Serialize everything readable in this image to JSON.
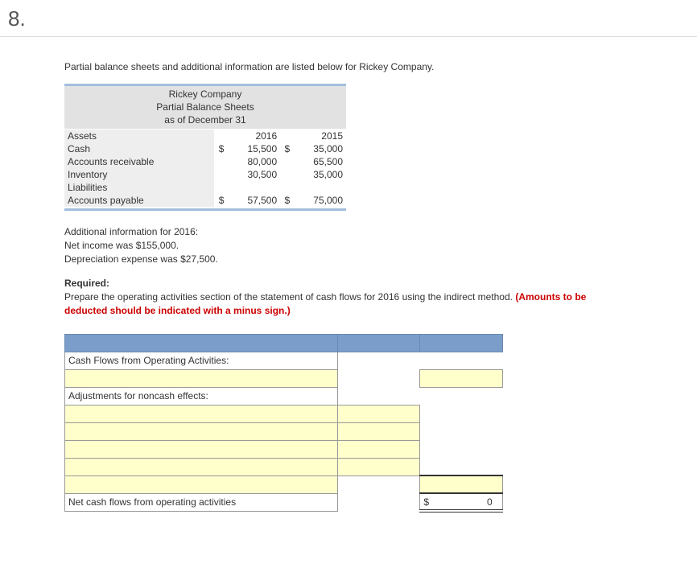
{
  "question_number": "8.",
  "intro": "Partial balance sheets and additional information are listed below for Rickey Company.",
  "bs": {
    "company": "Rickey Company",
    "title": "Partial Balance Sheets",
    "asof": "as of December 31",
    "col1": "2016",
    "col2": "2015",
    "rows": {
      "assets": {
        "label": "Assets"
      },
      "cash": {
        "label": "Cash",
        "c1s": "$",
        "c1": "15,500",
        "c2s": "$",
        "c2": "35,000"
      },
      "ar": {
        "label": "Accounts receivable",
        "c1": "80,000",
        "c2": "65,500"
      },
      "inv": {
        "label": "Inventory",
        "c1": "30,500",
        "c2": "35,000"
      },
      "liab": {
        "label": "Liabilities"
      },
      "ap": {
        "label": "Accounts payable",
        "c1s": "$",
        "c1": "57,500",
        "c2s": "$",
        "c2": "75,000"
      }
    }
  },
  "additional": {
    "heading": "Additional information for 2016:",
    "line1": "Net income was $155,000.",
    "line2": "Depreciation expense was $27,500."
  },
  "required": {
    "label": "Required:",
    "text": "Prepare the operating activities section of the statement of cash flows for 2016 using the indirect method.",
    "note": "(Amounts to be deducted should be indicated with a minus sign.)"
  },
  "ws": {
    "section1": "Cash Flows from Operating Activities:",
    "section2": "Adjustments for noncash effects:",
    "total_label": "Net cash flows from operating activities",
    "total_currency": "$",
    "total_value": "0"
  }
}
